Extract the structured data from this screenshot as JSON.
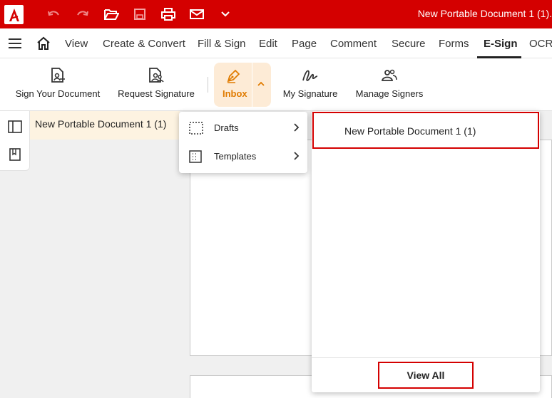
{
  "titlebar": {
    "document_title": "New Portable Document 1 (1).",
    "icons": [
      "app-logo",
      "undo-icon",
      "redo-icon",
      "open-folder-icon",
      "save-icon",
      "print-icon",
      "email-icon",
      "chevron-down-icon"
    ]
  },
  "menubar": {
    "items": [
      {
        "label": "View"
      },
      {
        "label": "Create & Convert"
      },
      {
        "label": "Fill & Sign"
      },
      {
        "label": "Edit"
      },
      {
        "label": "Page"
      },
      {
        "label": "Comment"
      },
      {
        "label": "Secure"
      },
      {
        "label": "Forms"
      },
      {
        "label": "E-Sign"
      },
      {
        "label": "OCR"
      }
    ],
    "active": "E-Sign"
  },
  "ribbon": {
    "sign_your_document": "Sign Your Document",
    "request_signature": "Request Signature",
    "inbox": "Inbox",
    "my_signature": "My Signature",
    "manage_signers": "Manage Signers"
  },
  "doc_tab": {
    "label": "New Portable Document 1 (1)"
  },
  "submenu": {
    "items": [
      {
        "label": "Drafts"
      },
      {
        "label": "Templates"
      }
    ]
  },
  "flyout": {
    "items": [
      {
        "label": "New Portable Document 1 (1)"
      }
    ],
    "view_all": "View All"
  },
  "colors": {
    "brand_red": "#d40000",
    "inbox_bg": "#fdebd6",
    "inbox_accent": "#e07b00",
    "tab_bg": "#fdf3e1"
  }
}
